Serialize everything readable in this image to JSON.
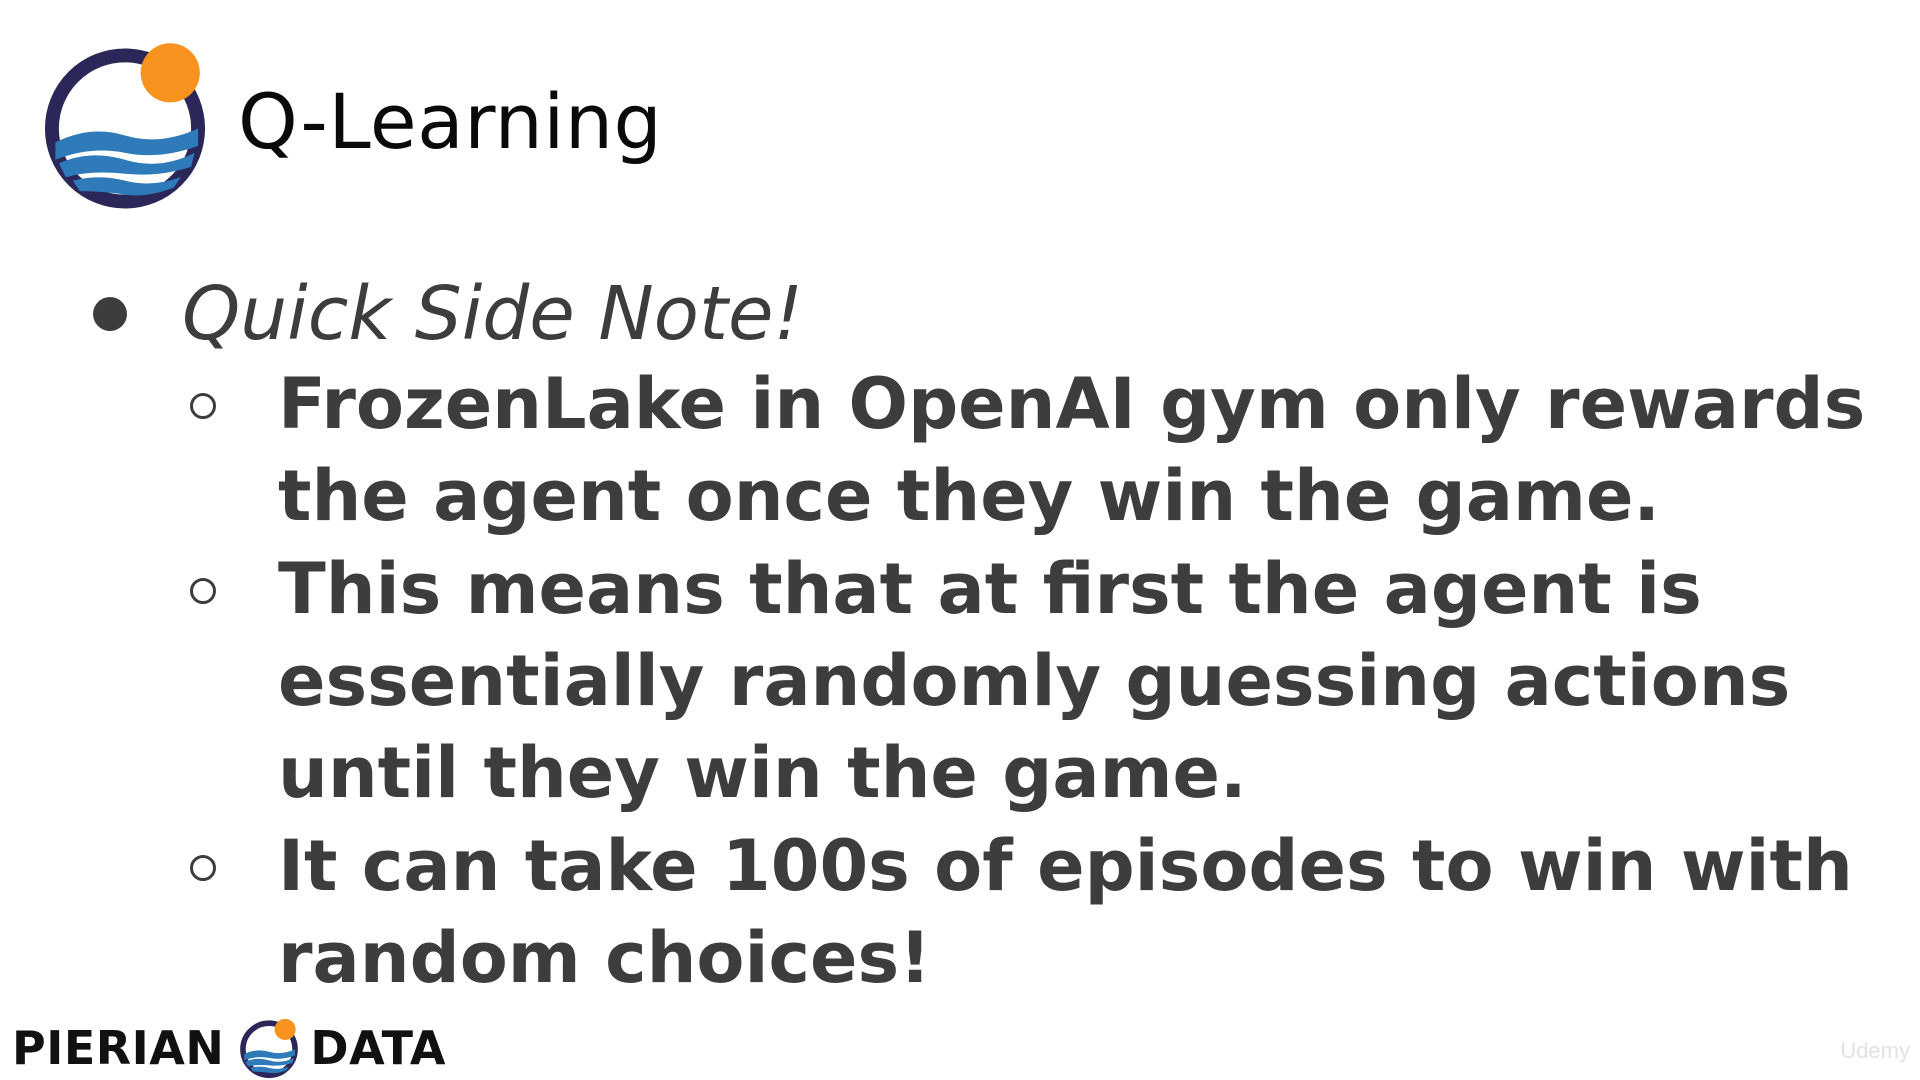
{
  "slide": {
    "title": "Q-Learning",
    "bullet": "Quick Side Note!",
    "sub_bullets": [
      {
        "lines": [
          "FrozenLake in OpenAI gym only rewards",
          "the agent once they win the game."
        ]
      },
      {
        "lines": [
          "This means that at first the agent is",
          "essentially randomly guessing actions",
          "until they win the game."
        ]
      },
      {
        "lines": [
          "It can take 100s of episodes to win with",
          "random choices!"
        ]
      }
    ]
  },
  "footer": {
    "brand_left": "PIERIAN",
    "brand_right": "DATA",
    "watermark": "Udemy"
  },
  "colors": {
    "logo_ring": "#2c2759",
    "logo_sun": "#f7931e",
    "logo_wave": "#2f7ab9",
    "text": "#3d3d3d",
    "title": "#0a0a0a"
  },
  "icons": [
    "pierian-data-logo-icon",
    "bullet-filled-icon",
    "bullet-hollow-icon"
  ]
}
